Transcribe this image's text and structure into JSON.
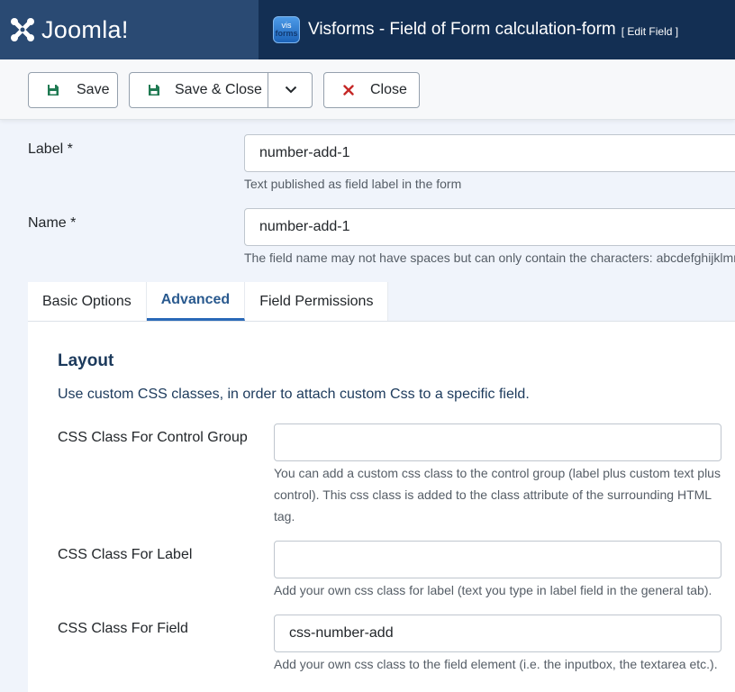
{
  "header": {
    "logo_text": "Joomla!",
    "component_icon_top": "vis",
    "component_icon_bottom": "forms",
    "title": "Visforms - Field of Form calculation-form",
    "subtitle": "[ Edit Field ]"
  },
  "toolbar": {
    "save_label": "Save",
    "save_close_label": "Save & Close",
    "close_label": "Close",
    "icons": [
      "floppy-disk-icon",
      "chevron-down-icon",
      "x-icon"
    ],
    "colors": {
      "save_icon": "#1f7a52",
      "close_icon": "#c52827"
    }
  },
  "fields": {
    "label": {
      "label": "Label *",
      "value": "number-add-1",
      "help": "Text published as field label in the form"
    },
    "name": {
      "label": "Name *",
      "value": "number-add-1",
      "help": "The field name may not have spaces but can only contain the characters: abcdefghijklmnopqrstuvwxyz"
    }
  },
  "tabs": [
    {
      "label": "Basic Options",
      "active": false
    },
    {
      "label": "Advanced",
      "active": true
    },
    {
      "label": "Field Permissions",
      "active": false
    }
  ],
  "layout_section": {
    "title": "Layout",
    "description": "Use custom CSS classes, in order to attach custom Css to a specific field.",
    "control_group": {
      "label": "CSS Class For Control Group",
      "value": "",
      "help": "You can add a custom css class to the control group (label plus custom text plus control). This css class is added to the class attribute of the surrounding HTML tag."
    },
    "label_class": {
      "label": "CSS Class For Label",
      "value": "",
      "help": "Add your own css class for label (text you type in label field in the general tab)."
    },
    "field_class": {
      "label": "CSS Class For Field",
      "value": "css-number-add",
      "help": "Add your own css class to the field element (i.e. the inputbox, the textarea etc.)."
    }
  },
  "colors": {
    "header_bg": "#132f53",
    "logo_bg": "#2a4a73",
    "page_bg": "#f0f4fb",
    "active_tab": "#2a5a8f"
  }
}
